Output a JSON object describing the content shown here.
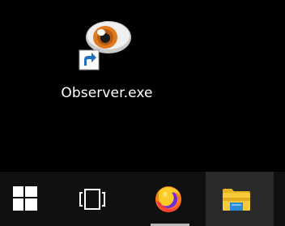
{
  "desktop": {
    "icons": [
      {
        "label": "Observer.exe",
        "icon": "observer-eye-icon",
        "shortcut_overlay": "shortcut-arrow-icon"
      }
    ]
  },
  "taskbar": {
    "buttons": [
      {
        "name": "start",
        "icon": "windows-logo-icon"
      },
      {
        "name": "task-view",
        "icon": "task-view-icon"
      },
      {
        "name": "firefox",
        "icon": "firefox-icon",
        "running": true
      },
      {
        "name": "file-explorer",
        "icon": "folder-icon",
        "active": true
      }
    ]
  },
  "colors": {
    "desktop_bg": "#000000",
    "taskbar_bg": "#101010",
    "active_button_bg": "#2a2a2a",
    "label_text": "#ffffff"
  }
}
